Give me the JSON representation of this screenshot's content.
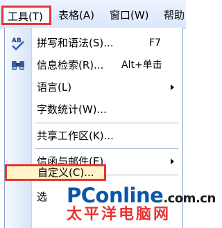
{
  "menubar": {
    "tools": "工具(T)",
    "table": "表格(A)",
    "window": "窗口(W)",
    "help": "帮助"
  },
  "menu": {
    "items": [
      {
        "label": "拼写和语法(S)...",
        "shortcut": "F7"
      },
      {
        "label": "信息检索(R)...",
        "shortcut": "Alt+单击"
      },
      {
        "label": "语言(L)"
      },
      {
        "label": "字数统计(W)..."
      },
      {
        "label": "共享工作区(K)..."
      },
      {
        "label": "信函与邮件(E)"
      },
      {
        "label": "自定义(C)..."
      },
      {
        "label": "选"
      }
    ]
  },
  "watermark": {
    "brand_p1": "PC",
    "brand_p2": "online",
    "brand_p3": ".com.cn",
    "subtitle": "太平洋电脑网"
  },
  "colors": {
    "highlight_border": "#e53535",
    "brand_blue": "#0a57a8",
    "brand_red": "#e53535"
  }
}
